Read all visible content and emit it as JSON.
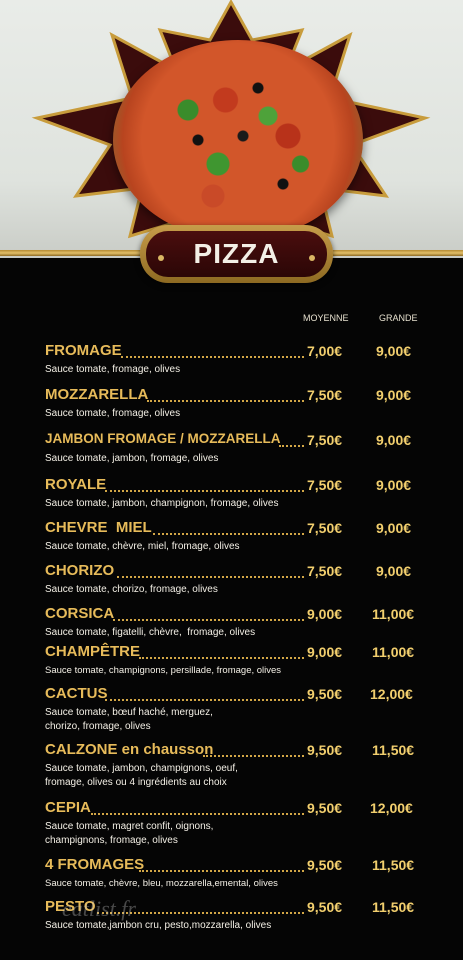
{
  "title": "PIZZA",
  "columns": {
    "medium": "MOYENNE",
    "large": "GRANDE"
  },
  "watermark": "eatlist.fr",
  "items": [
    {
      "name": "FROMAGE",
      "desc": "Sauce tomate, fromage, olives",
      "p1": "7,00€",
      "p2": "9,00€"
    },
    {
      "name": "MOZZARELLA",
      "desc": "Sauce tomate, fromage, olives",
      "p1": "7,50€",
      "p2": "9,00€"
    },
    {
      "name": "JAMBON FROMAGE / MOZZARELLA",
      "desc": "Sauce tomate, jambon, fromage, olives",
      "p1": "7,50€",
      "p2": "9,00€"
    },
    {
      "name": "ROYALE",
      "desc": "Sauce tomate, jambon, champignon, fromage, olives",
      "p1": "7,50€",
      "p2": "9,00€"
    },
    {
      "name": "CHEVRE  MIEL",
      "desc": "Sauce tomate, chèvre, miel, fromage, olives",
      "p1": "7,50€",
      "p2": "9,00€"
    },
    {
      "name": "CHORIZO",
      "desc": "Sauce tomate, chorizo, fromage, olives",
      "p1": "7,50€",
      "p2": "9,00€"
    },
    {
      "name": "CORSICA",
      "desc": "Sauce tomate, figatelli, chèvre,  fromage, olives",
      "p1": "9,00€",
      "p2": "11,00€"
    },
    {
      "name": "CHAMPÊTRE",
      "desc": "Sauce tomate, champignons, persillade, fromage, olives",
      "p1": "9,00€",
      "p2": "11,00€"
    },
    {
      "name": "CACTUS",
      "desc": "Sauce tomate, bœuf haché, merguez,",
      "desc2": "chorizo, fromage, olives",
      "p1": "9,50€",
      "p2": "12,00€"
    },
    {
      "name": "CALZONE en chausson",
      "desc": "Sauce tomate, jambon, champignons, oeuf,",
      "desc2": "fromage, olives ou 4 ingrédients au choix",
      "p1": "9,50€",
      "p2": "11,50€"
    },
    {
      "name": "CEPIA",
      "desc": "Sauce tomate, magret confit, oignons,",
      "desc2": "champignons, fromage, olives",
      "p1": "9,50€",
      "p2": "12,00€"
    },
    {
      "name": "4 FROMAGES",
      "desc": "Sauce tomate, chèvre, bleu, mozzarella,emental, olives",
      "p1": "9,50€",
      "p2": "11,50€"
    },
    {
      "name": "PESTO",
      "desc": "Sauce tomate,jambon cru, pesto,mozzarella, olives",
      "p1": "9,50€",
      "p2": "11,50€"
    }
  ]
}
